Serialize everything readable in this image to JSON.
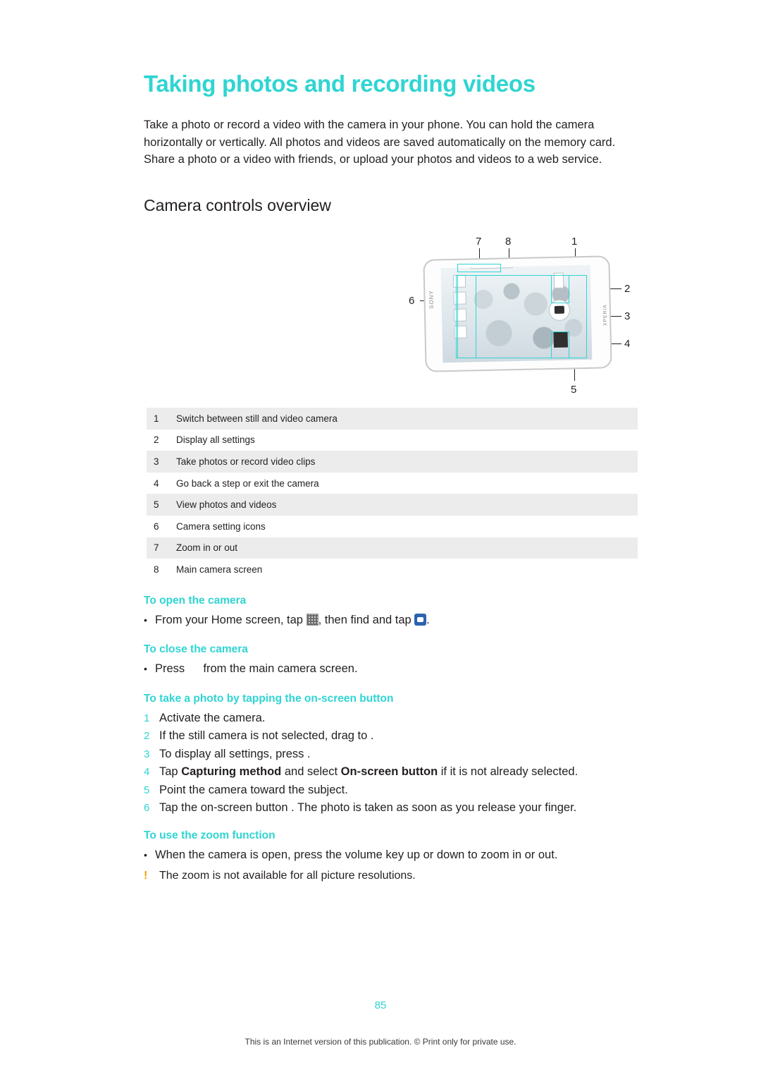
{
  "document": {
    "title": "Taking photos and recording videos",
    "intro": "Take a photo or record a video with the camera in your phone. You can hold the camera horizontally or vertically. All photos and videos are saved automatically on the memory card. Share a photo or a video with friends, or upload your photos and videos to a web service.",
    "section_heading": "Camera controls overview",
    "page_number": "85",
    "footer": "This is an Internet version of this publication. © Print only for private use."
  },
  "figure": {
    "callouts": [
      "7",
      "8",
      "1",
      "2",
      "3",
      "4",
      "5",
      "6"
    ],
    "device_brand": "SONY",
    "device_model": "XPERIA"
  },
  "legend": {
    "rows": [
      {
        "num": "1",
        "text": "Switch between still and video camera"
      },
      {
        "num": "2",
        "text": "Display all settings"
      },
      {
        "num": "3",
        "text": "Take photos or record video clips"
      },
      {
        "num": "4",
        "text": "Go back a step or exit the camera"
      },
      {
        "num": "5",
        "text": "View photos and videos"
      },
      {
        "num": "6",
        "text": "Camera setting icons"
      },
      {
        "num": "7",
        "text": "Zoom in or out"
      },
      {
        "num": "8",
        "text": "Main camera screen"
      }
    ]
  },
  "procedures": {
    "open_camera": {
      "heading": "To open the camera",
      "step_a": "From your Home screen, tap",
      "step_b": ", then find and tap",
      "step_c": "."
    },
    "close_camera": {
      "heading": "To close the camera",
      "step_a": "Press",
      "step_b": "from the main camera screen."
    },
    "tap_photo": {
      "heading": "To take a photo by tapping the on-screen button",
      "steps": [
        {
          "n": "1",
          "text": "Activate the camera."
        },
        {
          "n": "2",
          "text": "If the still camera is not selected, drag       to   ."
        },
        {
          "n": "3",
          "text": "To display all settings, press      ."
        },
        {
          "n": "4",
          "text": "Tap Capturing method and select On-screen button if it is not already selected.",
          "bold_1": "Capturing method",
          "bold_2": "On-screen button"
        },
        {
          "n": "5",
          "text": "Point the camera toward the subject."
        },
        {
          "n": "6",
          "text": "Tap the on-screen button   . The photo is taken as soon as you release your finger."
        }
      ]
    },
    "zoom_function": {
      "heading": "To use the zoom function",
      "bullet": "When the camera is open, press the volume key up or down to zoom in or out.",
      "note": "The zoom is not available for all picture resolutions."
    }
  },
  "colors": {
    "accent": "#2fd5d2",
    "text": "#231f20",
    "table_shade": "#ececec"
  }
}
